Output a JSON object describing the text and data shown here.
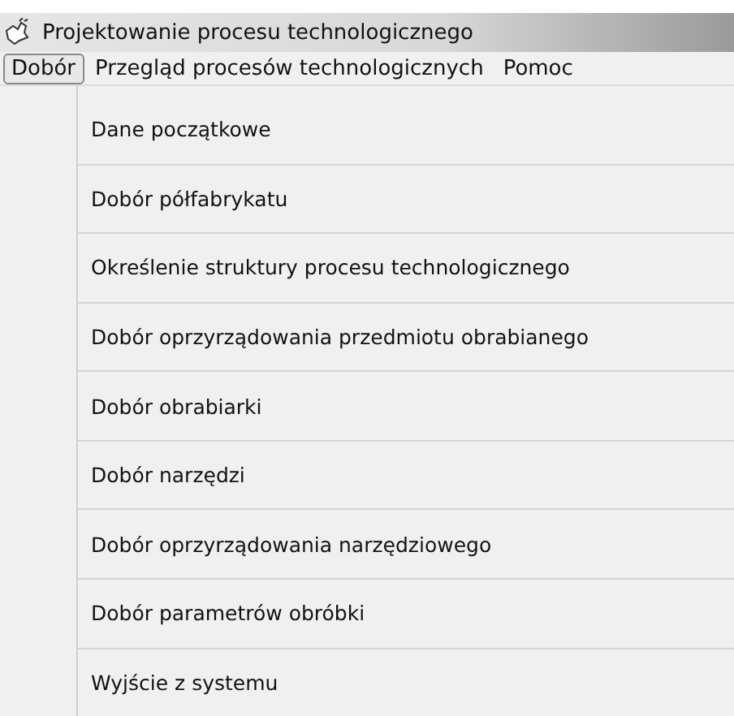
{
  "window": {
    "title": "Projektowanie procesu technologicznego"
  },
  "menubar": [
    {
      "label": "Dobór",
      "selected": true
    },
    {
      "label": "Przegląd procesów technologicznych",
      "selected": false
    },
    {
      "label": "Pomoc",
      "selected": false
    }
  ],
  "menu": {
    "items": [
      "Dane początkowe",
      "Dobór półfabrykatu",
      "Określenie struktury procesu technologicznego",
      "Dobór oprzyrządowania przedmiotu obrabianego",
      "Dobór obrabiarki",
      "Dobór narzędzi",
      "Dobór oprzyrządowania narzędziowego",
      "Dobór parametrów obróbki",
      "Wyjście z systemu"
    ]
  }
}
